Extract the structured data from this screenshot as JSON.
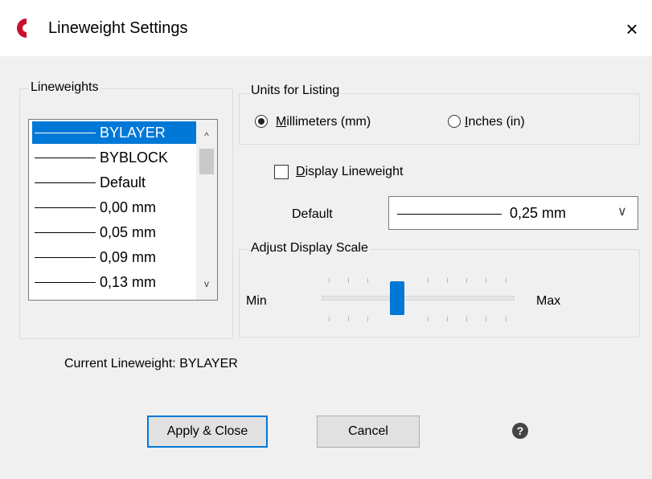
{
  "window": {
    "title": "Lineweight Settings",
    "close_glyph": "×",
    "app_icon": "app-logo-icon"
  },
  "lineweights": {
    "label": "Lineweights",
    "items": [
      {
        "label": "BYLAYER",
        "selected": true
      },
      {
        "label": "BYBLOCK",
        "selected": false
      },
      {
        "label": "Default",
        "selected": false
      },
      {
        "label": "0,00 mm",
        "selected": false
      },
      {
        "label": "0,05 mm",
        "selected": false
      },
      {
        "label": "0,09 mm",
        "selected": false
      },
      {
        "label": "0,13 mm",
        "selected": false
      }
    ],
    "scroll_up": "^",
    "scroll_down": "v"
  },
  "units": {
    "label": "Units for Listing",
    "millimeters": {
      "accel": "M",
      "rest": "illimeters (mm)",
      "checked": true
    },
    "inches": {
      "accel": "I",
      "rest": "nches (in)",
      "checked": false
    }
  },
  "display_lineweight": {
    "accel": "D",
    "rest": "isplay Lineweight",
    "checked": false
  },
  "default_combo": {
    "label": "Default",
    "value": "0,25 mm",
    "chevron": "∨"
  },
  "scale": {
    "label": "Adjust Display Scale",
    "min_label": "Min",
    "max_label": "Max",
    "level": 0.33
  },
  "status": {
    "current": "Current Lineweight: BYLAYER"
  },
  "buttons": {
    "apply": "Apply & Close",
    "cancel": "Cancel",
    "help": "?"
  },
  "colors": {
    "accent": "#0078d7",
    "app_icon": "#c8102e"
  }
}
